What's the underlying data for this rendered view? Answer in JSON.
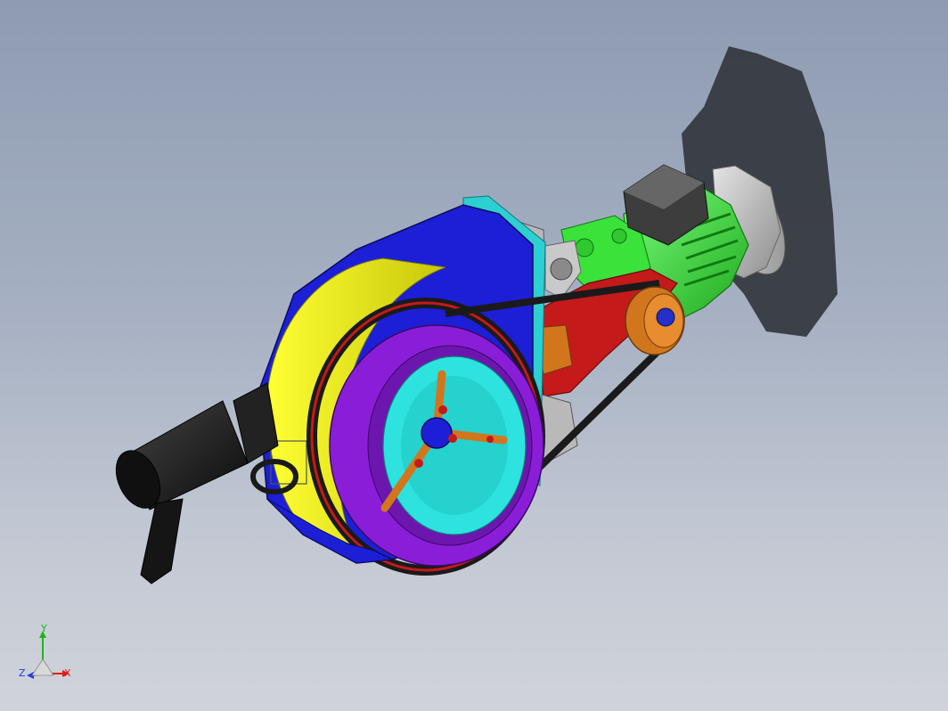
{
  "viewport": {
    "background_top": "#8e9bb2",
    "background_bottom": "#d0d3da"
  },
  "model": {
    "colors": {
      "housing": "#1c1fd6",
      "drum": "#e3e30e",
      "faceplate": "#8a1ed8",
      "belt": "#1a1a1a",
      "bracket": "#c41a1a",
      "motor": "#33e633",
      "motor_end": "#c8c8c8",
      "pulley": "#d2761e",
      "arms": "#d2761e",
      "inner_ring": "#39d9d4",
      "mount_plate": "#2ecfd0",
      "handle": "#141414",
      "block": "#bdbdbd",
      "shadow": "#3a3d44"
    }
  },
  "triad": {
    "y_label": "Y",
    "z_label": "Z",
    "x_label": "X",
    "x_color": "#e01c1c",
    "y_color": "#1cb51c",
    "z_color": "#1c3ce0"
  }
}
